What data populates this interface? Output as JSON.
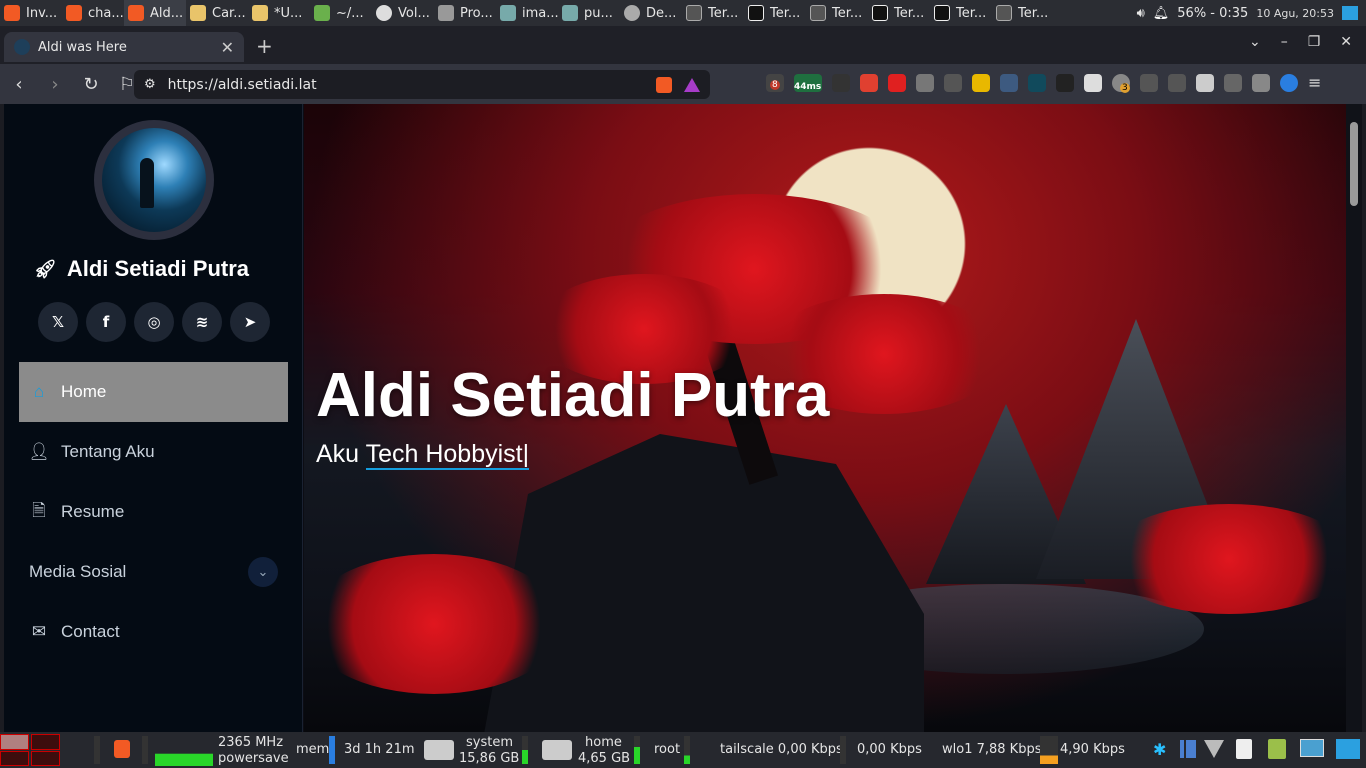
{
  "top_panel": {
    "tasks": [
      "Inv...",
      "cha...",
      "Ald...",
      "Car...",
      "*U...",
      "~/...",
      "Vol...",
      "Pro...",
      "ima...",
      "pu...",
      "De...",
      "Ter...",
      "Ter...",
      "Ter...",
      "Ter...",
      "Ter...",
      "Ter..."
    ],
    "battery": "56% - 0:35",
    "date_time": "10 Agu, 20:53"
  },
  "browser": {
    "tab_title": "Aldi was Here",
    "url": "https://aldi.setiadi.lat",
    "ext_badges": [
      "8",
      "44ms",
      "3"
    ]
  },
  "sidebar": {
    "name": "Aldi Setiadi Putra",
    "social": [
      {
        "icon": "x-icon",
        "glyph": "𝕏"
      },
      {
        "icon": "facebook-icon",
        "glyph": "f"
      },
      {
        "icon": "instagram-icon",
        "glyph": "◎"
      },
      {
        "icon": "spotify-icon",
        "glyph": "≋"
      },
      {
        "icon": "telegram-icon",
        "glyph": "➤"
      }
    ],
    "nav": {
      "home": "Home",
      "about": "Tentang Aku",
      "resume": "Resume",
      "media": "Media Sosial",
      "contact": "Contact"
    }
  },
  "hero": {
    "title": "Aldi Setiadi Putra",
    "prefix": "Aku",
    "typed": "Tech Hobbyist|"
  },
  "bottom_panel": {
    "cpu_freq": "2365 MHz",
    "cpu_governor": "powersave",
    "mem_label": "mem",
    "uptime": "3d 1h 21m",
    "system_label": "system",
    "system_size": "15,86 GB",
    "home_label": "home",
    "home_size": "4,65 GB",
    "root_label": "root",
    "tailscale": "tailscale 0,00 Kbps",
    "tailscale_up": "0,00 Kbps",
    "wlo1": "wlo1 7,88 Kbps",
    "wlo1_up": "4,90 Kbps"
  },
  "colors": {
    "accent": "#149ddd",
    "sidebar_bg": "#040b14",
    "active_nav": "#8b8b8b"
  }
}
